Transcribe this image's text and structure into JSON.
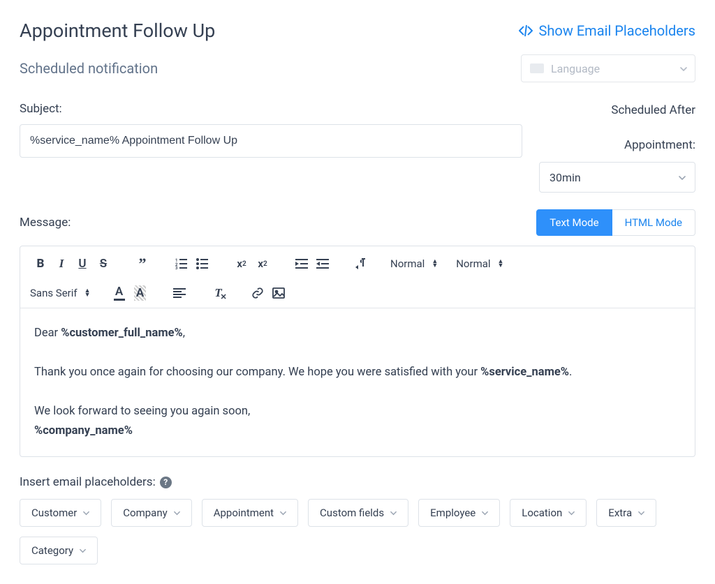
{
  "header": {
    "title": "Appointment Follow Up",
    "show_placeholders": "Show Email Placeholders",
    "subtitle": "Scheduled notification",
    "language_placeholder": "Language"
  },
  "subject": {
    "label": "Subject:",
    "value": "%service_name% Appointment Follow Up"
  },
  "schedule": {
    "scheduled_after": "Scheduled After",
    "appointment_label": "Appointment:",
    "duration_value": "30min"
  },
  "message": {
    "label": "Message:",
    "text_mode": "Text Mode",
    "html_mode": "HTML Mode"
  },
  "toolbar": {
    "bold": "B",
    "italic": "I",
    "underline": "U",
    "strike": "S",
    "heading": "Normal",
    "size": "Normal",
    "font": "Sans Serif"
  },
  "body": {
    "dear": "Dear ",
    "customer": "%customer_full_name%",
    "comma": ",",
    "line2a": "Thank you once again for choosing our company. We hope you were satisfied with your ",
    "service": "%service_name%",
    "period": ".",
    "line3": "We look forward to seeing you again soon,",
    "company": "%company_name%"
  },
  "placeholders": {
    "label": "Insert email placeholders:",
    "buttons": [
      "Customer",
      "Company",
      "Appointment",
      "Custom fields",
      "Employee",
      "Location",
      "Extra",
      "Category"
    ]
  }
}
